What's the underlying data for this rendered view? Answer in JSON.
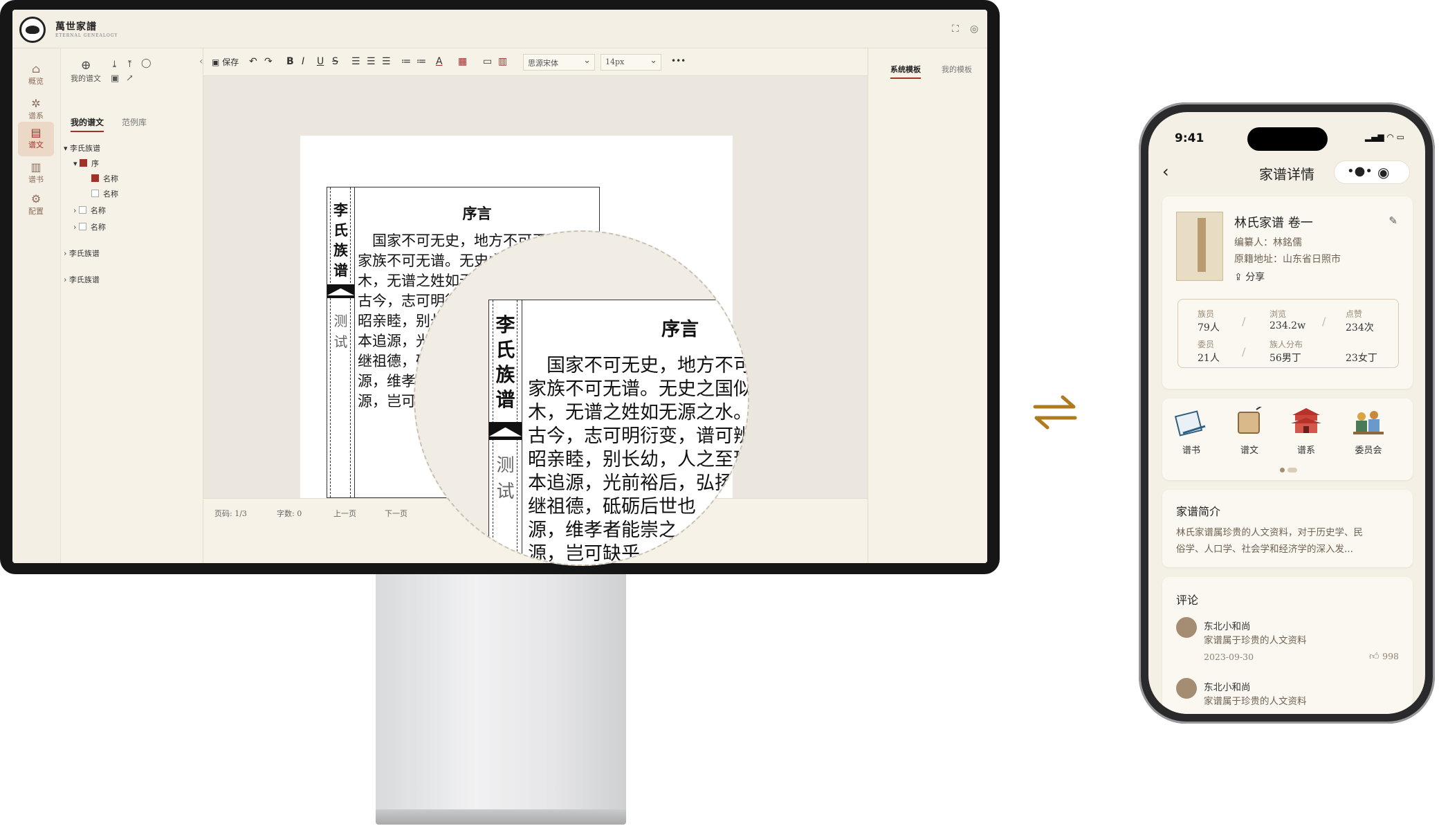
{
  "desktop": {
    "brand": "萬世家譜",
    "brand_sub": "ETERNAL GENEALOGY",
    "rail": [
      {
        "label": "概览",
        "icon": "home-icon"
      },
      {
        "label": "谱系",
        "icon": "tree-icon"
      },
      {
        "label": "谱文",
        "icon": "document-icon"
      },
      {
        "label": "谱书",
        "icon": "book-icon"
      },
      {
        "label": "配置",
        "icon": "gear-icon"
      }
    ],
    "tree_tools": {
      "new_label": "我的谱文"
    },
    "tree_tabs": [
      "我的谱文",
      "范例库"
    ],
    "tree": {
      "root1": "李氏族谱",
      "child1": "序",
      "grand1": "名称",
      "grand2": "名称",
      "child2": "名称",
      "child3": "名称",
      "root2": "李氏族谱",
      "root3": "李氏族谱"
    },
    "toolbar": {
      "save": "保存",
      "bold": "B",
      "italic": "I",
      "underline": "U",
      "strike": "S",
      "font_color": "A",
      "font_family": "思源宋体",
      "font_size": "14px",
      "more": "•••"
    },
    "right_tabs": [
      "系统模板",
      "我的模板"
    ],
    "status": {
      "page": "页码: 1/3",
      "words": "字数: 0",
      "prev": "上一页",
      "next": "下一页"
    }
  },
  "document": {
    "spine_title": [
      "李",
      "氏",
      "族",
      "谱"
    ],
    "spine_sub": [
      "测",
      "试"
    ],
    "heading": "序言",
    "lines": [
      "　国家不可无史，地方不可无志，",
      "家族不可无谱。无史之国似无本之",
      "木，无谱之姓如无源之水。史可知",
      "古今，志可明衍变，谱可辨支派，",
      "昭亲睦，别长幼，人之至理，报",
      "本追源，光前裕后，弘扬祖德，",
      "继祖德，砥砺后世也。文化渊",
      "源，维孝者能崇之。故族谱之",
      "源，岂可缺乎？是谱之"
    ]
  },
  "magnifier": {
    "spine_title": [
      "李",
      "氏",
      "族",
      "谱"
    ],
    "spine_sub": [
      "测",
      "试"
    ],
    "heading": "序言",
    "lines": [
      "　国家不可无史，地方不可",
      "家族不可无谱。无史之国似",
      "木，无谱之姓如无源之水。",
      "古今，志可明衍变，谱可辨",
      "昭亲睦，别长幼，人之至理",
      "本追源，光前裕后，弘扬",
      "继祖德，砥砺后世也",
      "源，维孝者能崇之",
      "源，岂可缺乎"
    ]
  },
  "phone": {
    "time": "9:41",
    "status_icons": "▂▄▆ ◠ ▭",
    "nav_title": "家谱详情",
    "book": {
      "title": "林氏家谱 卷一",
      "compiler": "编纂人：林銘儒",
      "origin": "原籍地址：山东省日照市",
      "share": "分享"
    },
    "stats": [
      {
        "label": "族员",
        "value": "79人"
      },
      {
        "label": "浏览",
        "value": "234.2w"
      },
      {
        "label": "点赞",
        "value": "234次"
      },
      {
        "label": "委员",
        "value": "21人"
      },
      {
        "label": "族人分布",
        "value": "56男丁"
      },
      {
        "label": "",
        "value": "23女丁"
      }
    ],
    "grid": [
      {
        "label": "谱书",
        "icon": "book-scroll-icon"
      },
      {
        "label": "谱文",
        "icon": "scroll-icon"
      },
      {
        "label": "谱系",
        "icon": "temple-icon"
      },
      {
        "label": "委员会",
        "icon": "committee-icon"
      }
    ],
    "intro": {
      "title": "家谱简介",
      "line1": "林氏家谱属珍贵的人文资料，对于历史学、民",
      "line2": "俗学、人口学、社会学和经济学的深入发..."
    },
    "comments": {
      "title": "评论",
      "items": [
        {
          "name": "东北小和尚",
          "text": "家谱属于珍贵的人文资料",
          "date": "2023-09-30",
          "likes": "998"
        },
        {
          "name": "东北小和尚",
          "text": "家谱属于珍贵的人文资料"
        }
      ]
    }
  },
  "colors": {
    "accent": "#a0322a",
    "paper": "#f6f2e8",
    "swap_arrow": "#b07a1e"
  }
}
